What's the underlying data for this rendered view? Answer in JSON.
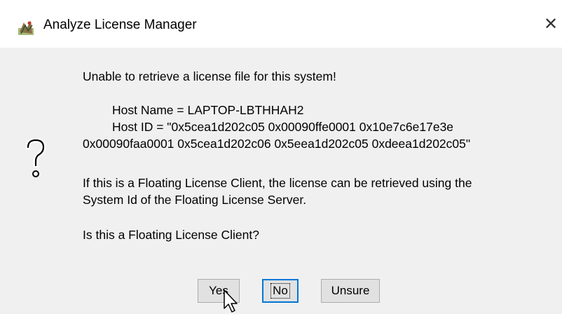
{
  "window": {
    "title": "Analyze License Manager",
    "close_glyph": "✕",
    "icon": "app-logo-icon"
  },
  "message": {
    "icon": "question-mark-icon",
    "line1": "Unable to retrieve a license file for this system!",
    "host_name": "Host Name = LAPTOP-LBTHHAH2",
    "host_id_line1": "Host ID = \"0x5cea1d202c05 0x00090ffe0001 0x10e7c6e17e3e",
    "host_id_line2": "0x00090faa0001 0x5cea1d202c06 0x5eea1d202c05 0xdeea1d202c05\"",
    "floating_line1": "If this is a Floating License Client, the license can be retrieved using the",
    "floating_line2": "System Id of the Floating License Server.",
    "question": "Is this a Floating License Client?"
  },
  "buttons": {
    "yes": "Yes",
    "no": "No",
    "unsure": "Unsure"
  }
}
